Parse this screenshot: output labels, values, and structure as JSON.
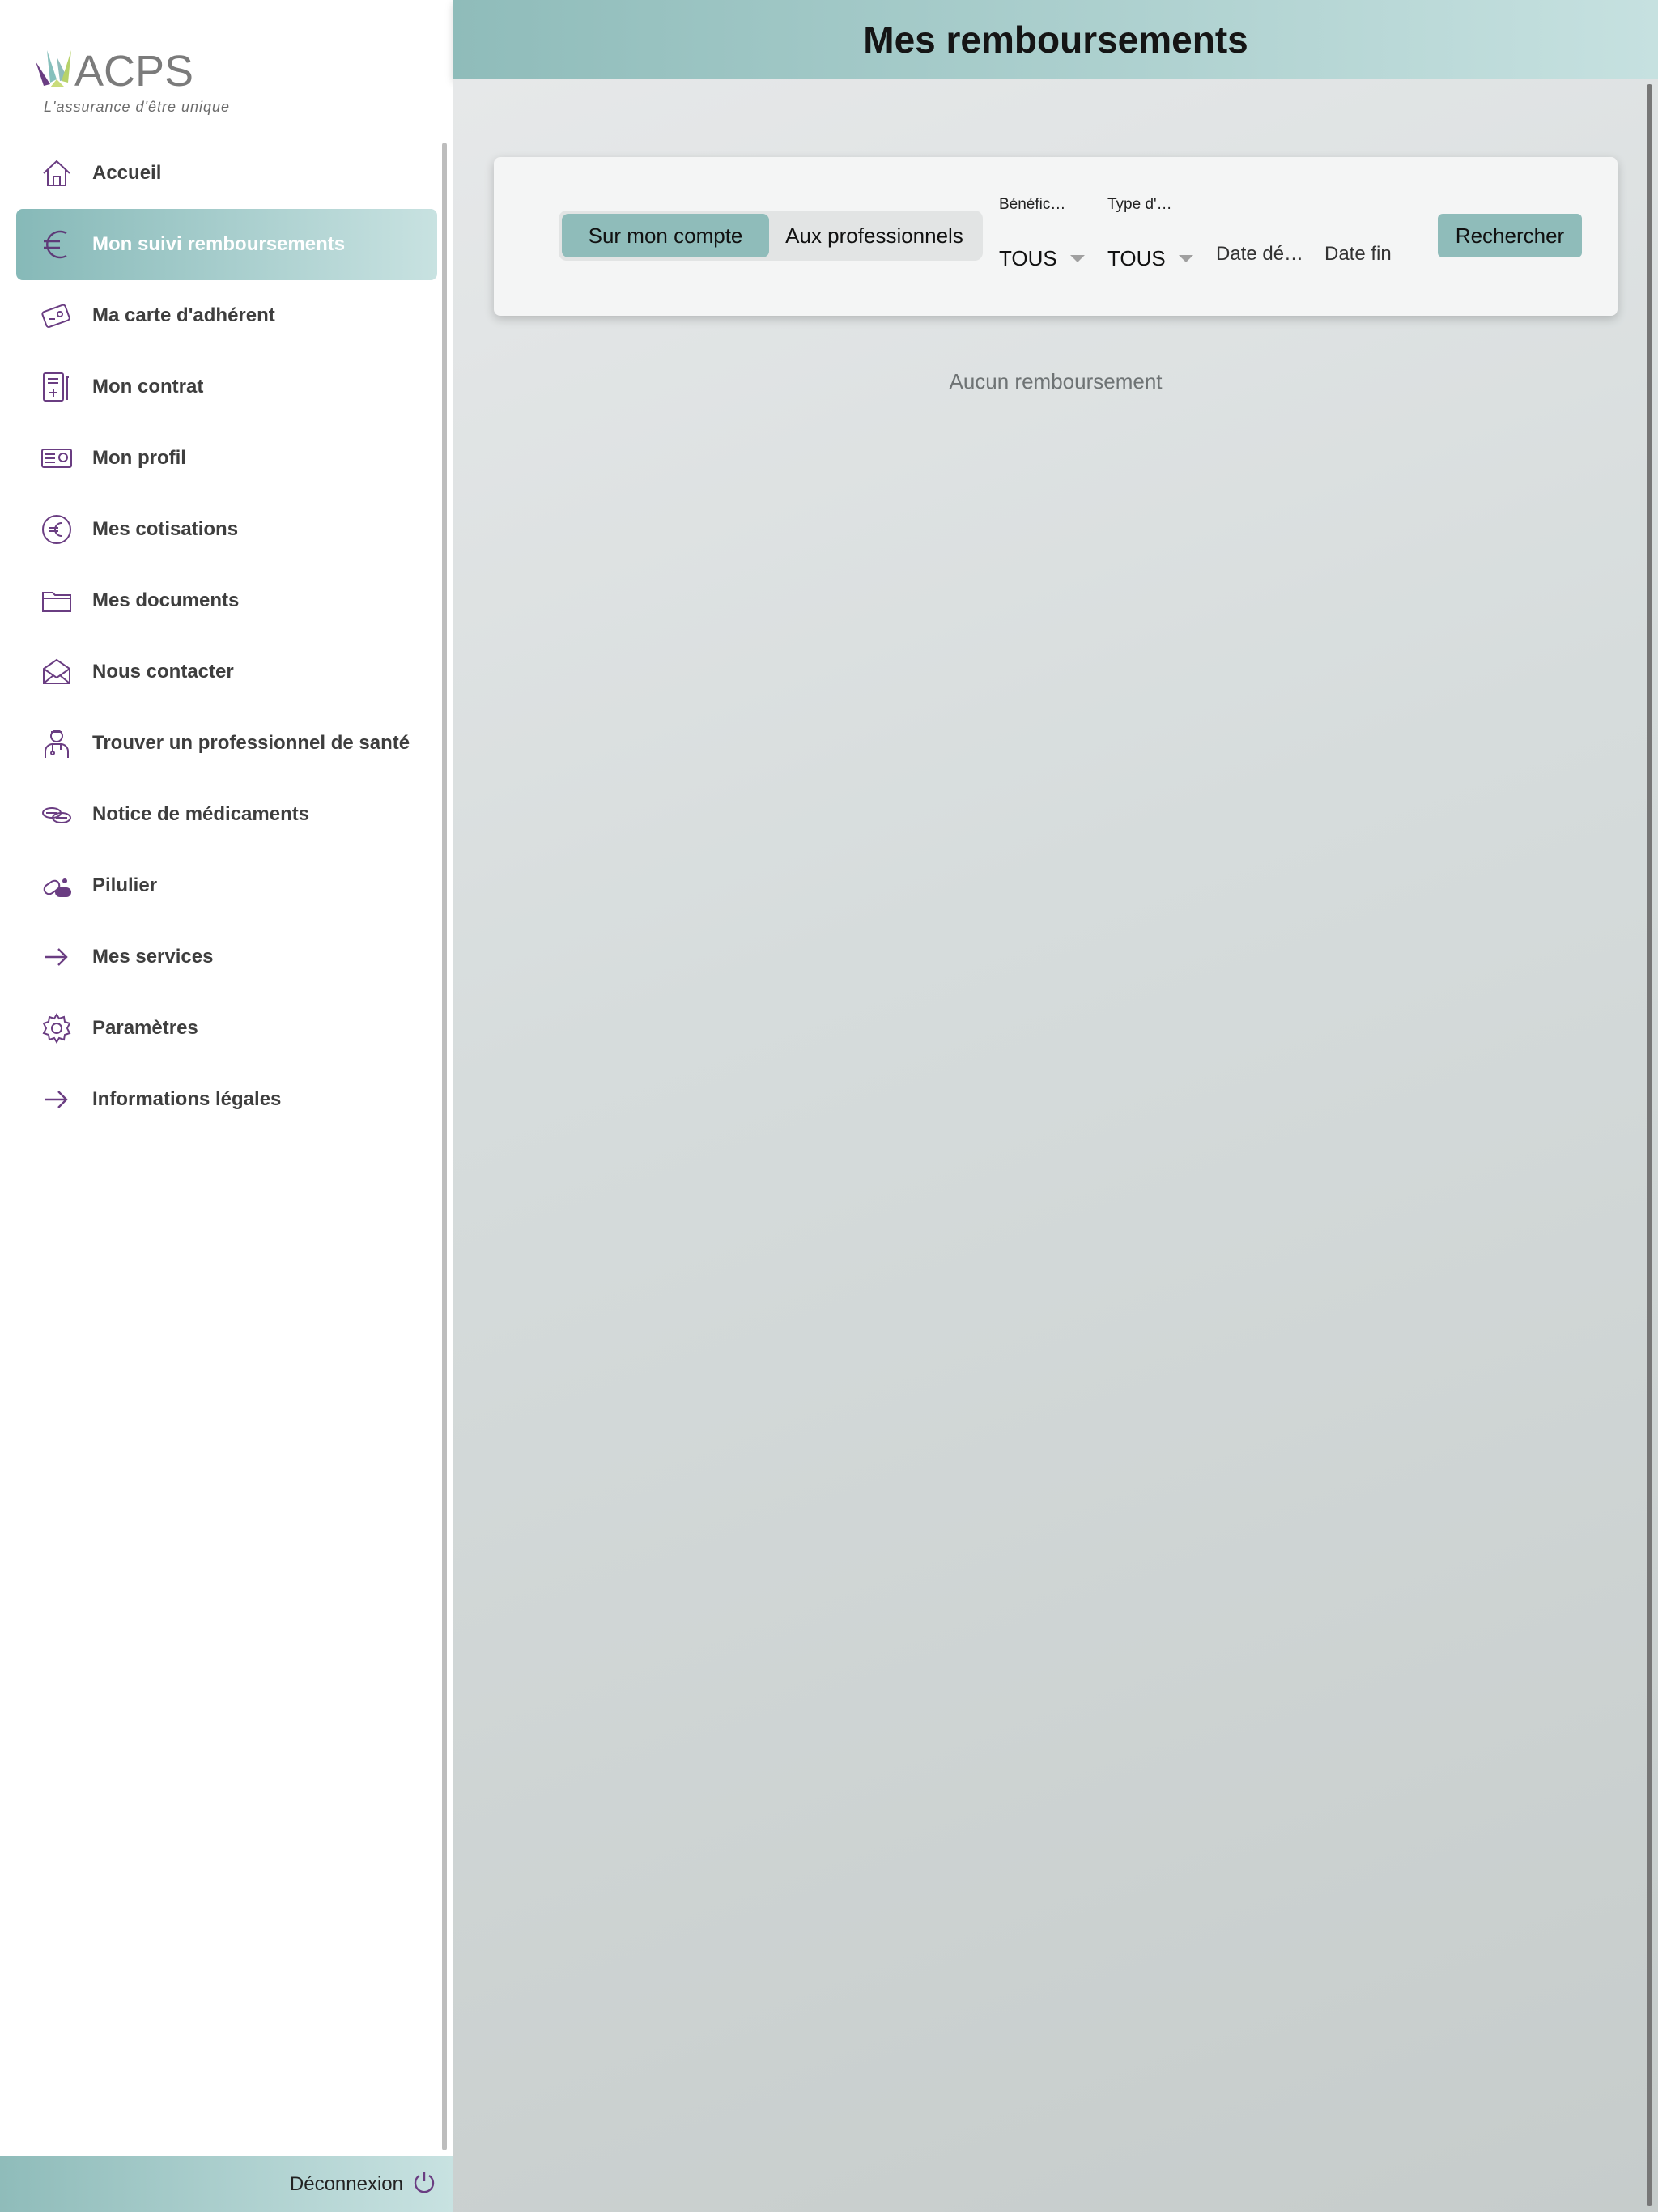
{
  "app": {
    "logo_text": "ACPS",
    "tagline": "L'assurance d'être unique"
  },
  "sidebar": {
    "items": [
      {
        "label": "Accueil",
        "icon": "home-icon"
      },
      {
        "label": "Mon suivi remboursements",
        "icon": "euro-icon",
        "active": true
      },
      {
        "label": "Ma carte d'adhérent",
        "icon": "card-icon"
      },
      {
        "label": "Mon contrat",
        "icon": "contract-icon"
      },
      {
        "label": "Mon profil",
        "icon": "profile-icon"
      },
      {
        "label": "Mes cotisations",
        "icon": "euro-circle-icon"
      },
      {
        "label": "Mes documents",
        "icon": "folder-icon"
      },
      {
        "label": "Nous contacter",
        "icon": "envelope-icon"
      },
      {
        "label": "Trouver un professionnel de santé",
        "icon": "doctor-icon"
      },
      {
        "label": "Notice de médicaments",
        "icon": "pills-icon"
      },
      {
        "label": "Pilulier",
        "icon": "pill-box-icon"
      },
      {
        "label": "Mes services",
        "icon": "arrow-right-icon"
      },
      {
        "label": "Paramètres",
        "icon": "gear-icon"
      },
      {
        "label": "Informations légales",
        "icon": "arrow-right-icon"
      }
    ],
    "logout_label": "Déconnexion"
  },
  "header": {
    "title": "Mes remboursements"
  },
  "filters": {
    "toggle": {
      "options": [
        "Sur mon compte",
        "Aux professionnels"
      ],
      "selected": "Sur mon compte"
    },
    "beneficiaire": {
      "label": "Bénéfic…",
      "value": "TOUS"
    },
    "type": {
      "label": "Type d'…",
      "value": "TOUS"
    },
    "date_debut": {
      "placeholder": "Date dé…"
    },
    "date_fin": {
      "placeholder": "Date fin"
    },
    "search_label": "Rechercher"
  },
  "results": {
    "empty_message": "Aucun remboursement"
  },
  "colors": {
    "accent": "#8fbcba",
    "icon": "#6a3d82",
    "header_gradient_end": "#c6e1e0"
  }
}
